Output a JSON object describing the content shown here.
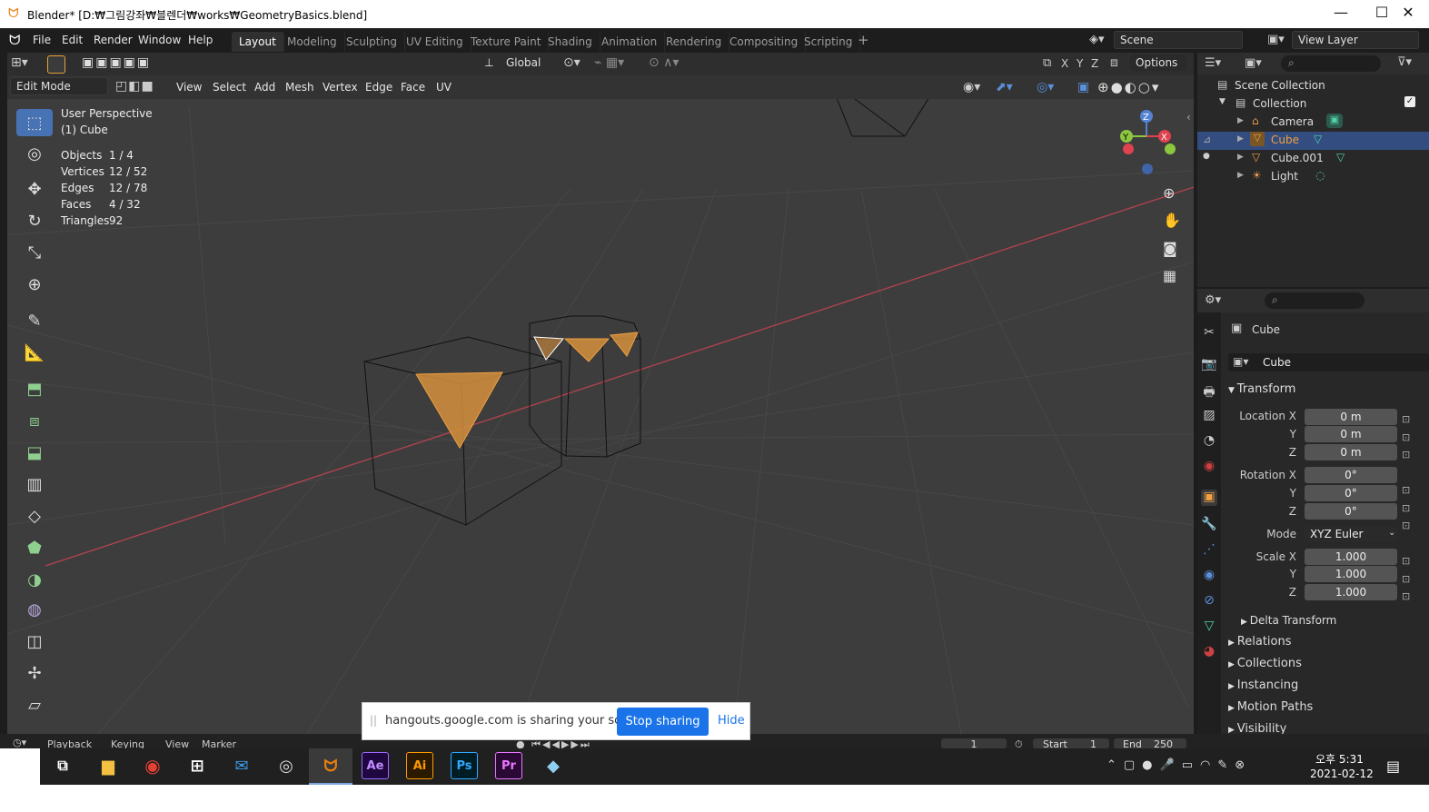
{
  "titlebar": {
    "app": "Blender* [D:₩그림강좌₩블렌더₩works₩GeometryBasics.blend]",
    "minimize": "—",
    "maximize": "☐",
    "close": "✕"
  },
  "menu": {
    "file": "File",
    "edit": "Edit",
    "render": "Render",
    "window": "Window",
    "help": "Help"
  },
  "workspaces": [
    "Layout",
    "Modeling",
    "Sculpting",
    "UV Editing",
    "Texture Paint",
    "Shading",
    "Animation",
    "Rendering",
    "Compositing",
    "Scripting"
  ],
  "add_workspace": "+",
  "scene": {
    "label": "Scene"
  },
  "view_layer": {
    "label": "View Layer"
  },
  "header": {
    "transform_orientation": "Global",
    "options": "Options",
    "x": "X",
    "y": "Y",
    "z": "Z"
  },
  "editmode": {
    "mode": "Edit Mode",
    "view": "View",
    "select": "Select",
    "add": "Add",
    "mesh": "Mesh",
    "vertex": "Vertex",
    "edge": "Edge",
    "face": "Face",
    "uv": "UV"
  },
  "overlay": {
    "perspective": "User Perspective",
    "object": "(1) Cube",
    "stats": [
      {
        "label": "Objects",
        "value": "1 / 4"
      },
      {
        "label": "Vertices",
        "value": "12 / 52"
      },
      {
        "label": "Edges",
        "value": "12 / 78"
      },
      {
        "label": "Faces",
        "value": "4 / 32"
      },
      {
        "label": "Triangles",
        "value": "92"
      }
    ]
  },
  "gizmo": {
    "x": "X",
    "y": "Y",
    "z": "Z"
  },
  "outliner": {
    "scene_collection": "Scene Collection",
    "collection": "Collection",
    "items": [
      "Camera",
      "Cube",
      "Cube.001",
      "Light"
    ]
  },
  "properties": {
    "object_name": "Cube",
    "data_name": "Cube",
    "transform": "Transform",
    "location_x": "Location X",
    "rotation_x": "Rotation X",
    "scale_x": "Scale X",
    "y": "Y",
    "z": "Z",
    "mode_label": "Mode",
    "mode_value": "XYZ Euler",
    "loc": [
      "0 m",
      "0 m",
      "0 m"
    ],
    "rot": [
      "0°",
      "0°",
      "0°"
    ],
    "scale": [
      "1.000",
      "1.000",
      "1.000"
    ],
    "sections": [
      "Delta Transform",
      "Relations",
      "Collections",
      "Instancing",
      "Motion Paths",
      "Visibility"
    ]
  },
  "timeline": {
    "playback": "Playback",
    "keying": "Keying",
    "view": "View",
    "marker": "Marker",
    "frame": "1",
    "start_label": "Start",
    "start": "1",
    "end_label": "End",
    "end": "250"
  },
  "share": {
    "message": "hangouts.google.com is sharing your screen.",
    "stop": "Stop sharing",
    "hide": "Hide"
  },
  "taskbar": {
    "ae": "Ae",
    "ai": "Ai",
    "ps": "Ps",
    "pr": "Pr",
    "time": "오후 5:31",
    "date": "2021-02-12"
  }
}
